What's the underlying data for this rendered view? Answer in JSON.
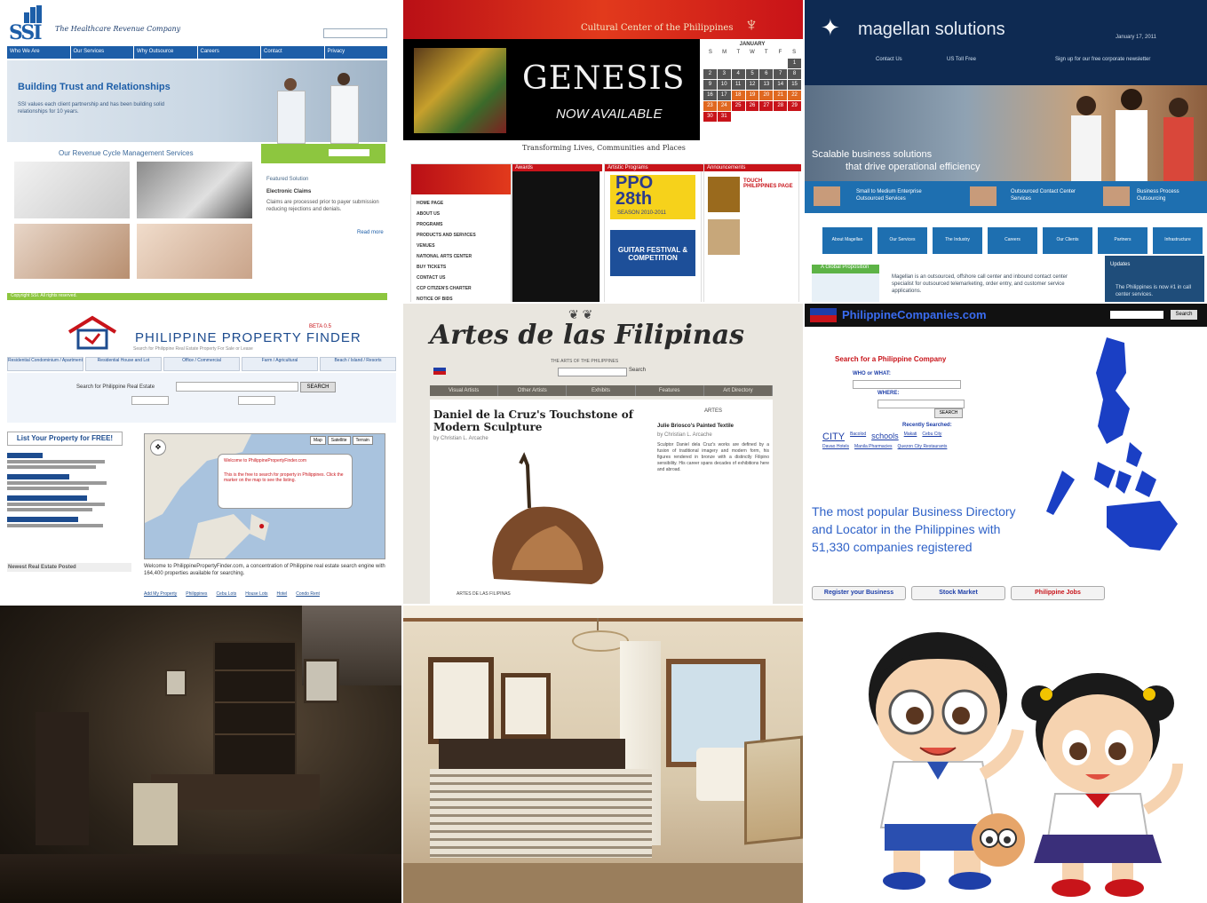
{
  "ssi": {
    "tagline": "The Healthcare Revenue Company",
    "nav": [
      "Who We Are",
      "Our Services",
      "Why Outsource",
      "Careers",
      "Contact",
      "Privacy"
    ],
    "hero_title": "Building Trust and Relationships",
    "hero_text": "SSI values each client partnership and has been building solid relationships for 10 years.",
    "services_title": "Our Revenue Cycle Management Services",
    "featured_label": "Featured Solution",
    "featured_name": "Electronic Claims",
    "featured_text": "Claims are processed prior to payer submission reducing rejections and denials.",
    "read_more": "Read more",
    "footer": "Copyright SSI. All rights reserved.",
    "colors": {
      "accent": "#1d5ea8",
      "green": "#8dc63f"
    }
  },
  "ccp": {
    "header": "Cultural Center of the Philippines",
    "hero_title": "GENESIS",
    "hero_sub": "NOW AVAILABLE",
    "calendar_month": "JANUARY",
    "weekdays": [
      "S",
      "M",
      "T",
      "W",
      "T",
      "F",
      "S"
    ],
    "days": [
      "",
      "",
      "",
      "",
      "",
      "",
      "1",
      "2",
      "3",
      "4",
      "5",
      "6",
      "7",
      "8",
      "9",
      "10",
      "11",
      "12",
      "13",
      "14",
      "15",
      "16",
      "17",
      "18",
      "19",
      "20",
      "21",
      "22",
      "23",
      "24",
      "25",
      "26",
      "27",
      "28",
      "29",
      "30",
      "31"
    ],
    "tagline": "Transforming Lives, Communities and Places",
    "menu": [
      "HOME PAGE",
      "ABOUT US",
      "PROGRAMS",
      "PRODUCTS AND SERVICES",
      "VENUES",
      "NATIONAL ARTS CENTER",
      "BUY TICKETS",
      "CONTACT US",
      "CCP CITIZEN'S CHARTER",
      "NOTICE OF BIDS"
    ],
    "col_headers": [
      "Awards",
      "Artistic Programs",
      "Announcements"
    ],
    "ppo_big": "PPO",
    "ppo_num": "28th",
    "ppo_season": "SEASON 2010-2011",
    "guitar_text": "GUITAR FESTIVAL & COMPETITION",
    "side_text": "TOUCH PHILIPPINES PAGE",
    "colors": {
      "red": "#c8141a"
    }
  },
  "magellan": {
    "logo": "magellan solutions",
    "date": "January 17, 2011",
    "top_links": [
      "Contact Us",
      "US Toll Free",
      "Sign up for our free corporate newsletter"
    ],
    "hero_line1": "Scalable business solutions",
    "hero_line2": "that drive operational efficiency",
    "strip": [
      "Small to Medium Enterprise Outsourced Services",
      "Outsourced Contact Center Services",
      "Business Process Outsourcing"
    ],
    "nav": [
      "About Magellan",
      "Our Services",
      "The Industry",
      "Careers",
      "Our Clients",
      "Partners",
      "Infrastructure"
    ],
    "box_title": "A Global Proposition",
    "body": "Magellan is an outsourced, offshore call center and inbound contact center specialist for outsourced telemarketing, order entry, and customer service applications.",
    "updates_title": "Updates",
    "updates_text": "The Philippines is now #1 in call center services.",
    "colors": {
      "navy": "#12305a",
      "blue": "#1e6fb0"
    }
  },
  "ppf": {
    "logo_text": "PHILIPPINE PROPERTY FINDER",
    "beta": "BETA 0.5",
    "subtitle": "Search for Philippine Real Estate Property For Sale or Lease",
    "tabs": [
      "Residential Condominium / Apartment",
      "Residential House and Lot",
      "Office / Commercial",
      "Farm / Agricultural",
      "Beach / Island / Resorts"
    ],
    "search_label": "Search for Philippine Real Estate",
    "search_button": "SEARCH",
    "list_button": "List Your Property for FREE!",
    "map_tabs": [
      "Map",
      "Satellite",
      "Terrain"
    ],
    "balloon_title": "Welcome to PhilippinePropertyFinder.com",
    "balloon_text": "This is the free to search for property in Philippines. Click the marker on the map to see the listing.",
    "listings_header": "Newest Real Estate Posted",
    "welcome": "Welcome to PhilippinePropertyFinder.com, a concentration of Philippine real estate search engine with 164,400 properties available for searching.",
    "links": [
      "Add My Property",
      "Philippines",
      "Cebu Lots",
      "House Lots",
      "Hotel",
      "Condo Rent"
    ],
    "colors": {
      "brand": "#c8141a",
      "blue": "#1d4c8f"
    }
  },
  "artes": {
    "title": "Artes de las Filipinas",
    "subtitle": "THE ARTS OF THE PHILIPPINES",
    "search_button": "Search",
    "nav": [
      "Visual Artists",
      "Other Artists",
      "Exhibits",
      "Features",
      "Art Directory"
    ],
    "headline": "Daniel de la Cruz's Touchstone of Modern Sculpture",
    "byline": "by Christian L. Arcache",
    "side_header": "ARTES",
    "side_title": "Julie Briosco's Painted Textile",
    "side_byline": "by Christian L. Arcache",
    "caption": "ARTES DE LAS FILIPINAS",
    "body": "Sculptor Daniel dela Cruz's works are defined by a fusion of traditional imagery and modern form, his figures rendered in bronze with a distinctly Filipino sensibility. His career spans decades of exhibitions here and abroad."
  },
  "ppc": {
    "logo": "PhilippineCompanies.com",
    "search_button": "Search",
    "search_title": "Search for a Philippine Company",
    "what_label": "WHO or WHAT:",
    "where_label": "WHERE:",
    "find_button": "SEARCH",
    "recent_title": "Recently Searched:",
    "recent_terms": [
      "CITY",
      "Bacolod",
      "schools",
      "Makati",
      "Cebu City",
      "Davao Hotels",
      "Manila Pharmacies",
      "Quezon City Restaurants"
    ],
    "headline": "The most popular Business Directory and Locator in the Philippines with 51,330 companies registered",
    "buttons": [
      "Register your Business",
      "Stock Market",
      "Philippine Jobs"
    ],
    "colors": {
      "map": "#1a3fc4",
      "headline": "#2f62c8"
    }
  }
}
